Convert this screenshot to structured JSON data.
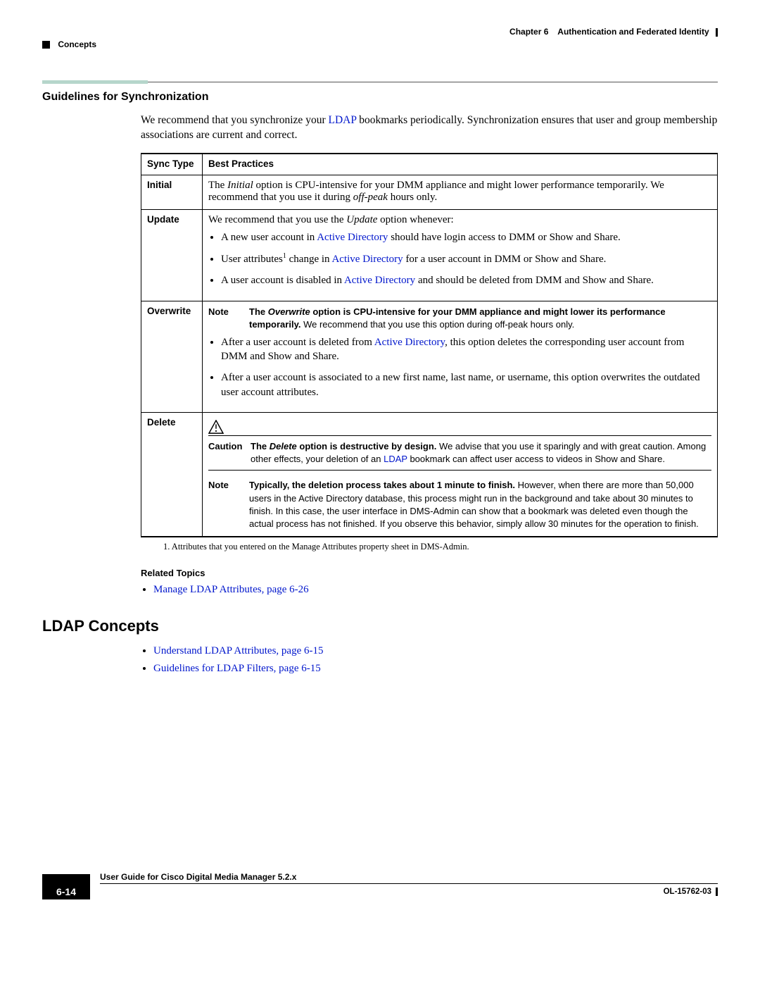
{
  "header": {
    "chapter_label": "Chapter 6",
    "chapter_title": "Authentication and Federated Identity",
    "section": "Concepts"
  },
  "h3": "Guidelines for Synchronization",
  "intro": {
    "pre": "We recommend that you synchronize your ",
    "link": "LDAP",
    "post": " bookmarks periodically. Synchronization ensures that user and group membership associations are current and correct."
  },
  "table": {
    "th_type": "Sync Type",
    "th_best": "Best Practices",
    "initial": {
      "label": "Initial",
      "t1": "The ",
      "t2": "Initial",
      "t3": " option is CPU-intensive for your DMM appliance and might lower performance temporarily. We recommend that you use it during ",
      "t4": "off-peak",
      "t5": " hours only."
    },
    "update": {
      "label": "Update",
      "lead_a": "We recommend that you use the ",
      "lead_b": "Update",
      "lead_c": " option whenever:",
      "b1a": "A new user account in ",
      "b1b": "Active Directory",
      "b1c": " should have login access to DMM or Show and Share.",
      "b2a": "User attributes",
      "b2sup": "1",
      "b2b": " change in ",
      "b2c": "Active Directory",
      "b2d": " for a user account in DMM or Show and Share.",
      "b3a": "A user account is disabled in ",
      "b3b": "Active Directory",
      "b3c": " and should be deleted from DMM and Show and Share."
    },
    "overwrite": {
      "label": "Overwrite",
      "note_label": "Note",
      "note_a": "The ",
      "note_b": "Overwrite",
      "note_c": " option is CPU-intensive for your DMM appliance and might lower its performance temporarily.",
      "note_d": " We recommend that you use this option during off-peak hours only.",
      "b1a": "After a user account is deleted from ",
      "b1b": "Active Directory",
      "b1c": ", this option deletes the corresponding user account from DMM and Show and Share.",
      "b2": "After a user account is associated to a new first name, last name, or username, this option overwrites the outdated user account attributes."
    },
    "delete": {
      "label": "Delete",
      "caution_label": "Caution",
      "c_a": "The ",
      "c_b": "Delete",
      "c_c": " option is destructive by design.",
      "c_d": " We advise that you use it sparingly and with great caution. Among other effects, your deletion of an ",
      "c_link": "LDAP",
      "c_e": " bookmark can affect user access to videos in Show and Share.",
      "note_label": "Note",
      "n_a": "Typically, the deletion process takes about 1 minute to finish.",
      "n_b": " However, when there are more than 50,000 users in the Active Directory database, this process might run in the background and take about 30 minutes to finish. In this case, the user interface in DMS-Admin can show that a bookmark was deleted even though the actual process has not finished. If you observe this behavior, simply allow 30 minutes for the operation to finish."
    }
  },
  "footnote": "1.   Attributes that you entered on the Manage Attributes property sheet in DMS-Admin.",
  "related": {
    "heading": "Related Topics",
    "item1": "Manage LDAP Attributes, page 6-26"
  },
  "h2": "LDAP Concepts",
  "ldap_list": {
    "i1": "Understand LDAP Attributes, page 6-15",
    "i2": "Guidelines for LDAP Filters, page 6-15"
  },
  "footer": {
    "guide": "User Guide for Cisco Digital Media Manager 5.2.x",
    "page": "6-14",
    "doc": "OL-15762-03"
  }
}
